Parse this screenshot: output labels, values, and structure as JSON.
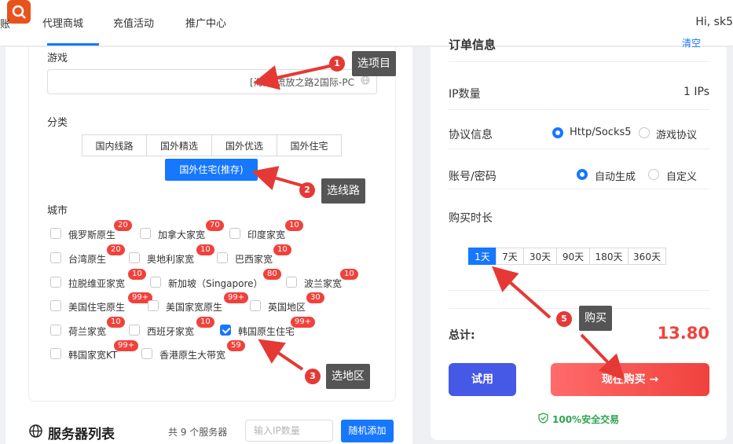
{
  "topbar": {
    "nav_fragment": "账",
    "nav": [
      "代理商城",
      "充值活动",
      "推广中心"
    ],
    "greeting": "Hi, sk5"
  },
  "left": {
    "game_label": "游戏",
    "game_value": "[海外]流放之路2国际-PC",
    "category_label": "分类",
    "categories": [
      "国内线路",
      "国外精选",
      "国外优选",
      "国外住宅"
    ],
    "recommended": "国外住宅(推存)",
    "city_label": "城市",
    "cities": [
      {
        "name": "俄罗斯原生",
        "badge": "20",
        "checked": false
      },
      {
        "name": "加拿大家宽",
        "badge": "70",
        "checked": false
      },
      {
        "name": "印度家宽",
        "badge": "10",
        "checked": false
      },
      {
        "name": "台湾原生",
        "badge": "20",
        "checked": false
      },
      {
        "name": "奥地利家宽",
        "badge": "10",
        "checked": false
      },
      {
        "name": "巴西家宽",
        "badge": "10",
        "checked": false
      },
      {
        "name": "拉脱维亚家宽",
        "badge": "10",
        "checked": false
      },
      {
        "name": "新加坡（Singapore）",
        "badge": "80",
        "checked": false
      },
      {
        "name": "波兰家宽",
        "badge": "10",
        "checked": false
      },
      {
        "name": "美国住宅原生",
        "badge": "99+",
        "checked": false
      },
      {
        "name": "美国家宽原生",
        "badge": "99+",
        "checked": false
      },
      {
        "name": "英国地区",
        "badge": "30",
        "checked": false
      },
      {
        "name": "荷兰家宽",
        "badge": "10",
        "checked": false
      },
      {
        "name": "西班牙家宽",
        "badge": "10",
        "checked": false
      },
      {
        "name": "韩国原生住宅",
        "badge": "99+",
        "checked": true
      },
      {
        "name": "韩国家宽KT",
        "badge": "99+",
        "checked": false
      },
      {
        "name": "香港原生大带宽",
        "badge": "59",
        "checked": false
      }
    ]
  },
  "server": {
    "title": "服务器列表",
    "count_text": "共 9 个服务器",
    "input_placeholder": "输入IP数量",
    "random_button": "随机添加"
  },
  "order": {
    "header": "订单信息",
    "header_link": "清空",
    "ip_label": "IP数量",
    "ip_value": "1 IPs",
    "protocol_label": "协议信息",
    "protocol_options": [
      "Http/Socks5",
      "游戏协议"
    ],
    "protocol_selected": "Http/Socks5",
    "account_label": "账号/密码",
    "account_options": [
      "自动生成",
      "自定义"
    ],
    "account_selected": "自动生成",
    "duration_label": "购买时长",
    "durations": [
      "1天",
      "7天",
      "30天",
      "90天",
      "180天",
      "360天"
    ],
    "duration_selected": "1天",
    "total_label": "总计:",
    "total_value": "13.80",
    "trial_button": "试用",
    "buy_button": "现在购买 →",
    "secure_text": "100%安全交易"
  },
  "annotations": [
    {
      "num": "1",
      "text": "选项目"
    },
    {
      "num": "2",
      "text": "选线路"
    },
    {
      "num": "3",
      "text": "选地区"
    },
    {
      "num": "5",
      "text": "购买"
    }
  ],
  "colors": {
    "accent": "#1677ff",
    "badge": "#f0423c",
    "annotation": "#e53935",
    "total": "#f0423c",
    "trial": "#4658e6"
  }
}
